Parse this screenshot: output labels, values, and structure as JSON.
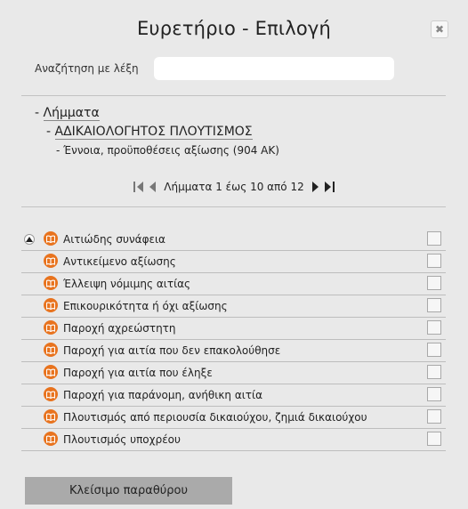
{
  "dialog": {
    "title": "Ευρετήριο - Επιλογή",
    "close_icon": "close-icon"
  },
  "search": {
    "label": "Αναζήτηση με λέξη",
    "value": "",
    "placeholder": ""
  },
  "breadcrumb": {
    "level1": "Λήμματα",
    "level2": "ΑΔΙΚΑΙΟΛΟΓΗΤΟΣ ΠΛΟΥΤΙΣΜΟΣ",
    "level3": "Έννοια, προϋποθέσεις αξίωσης (904 ΑΚ)"
  },
  "pager": {
    "text": "Λήμματα 1 έως 10 από 12"
  },
  "entries": [
    {
      "label": "Αιτιώδης συνάφεια"
    },
    {
      "label": "Αντικείμενο αξίωσης"
    },
    {
      "label": "Έλλειψη νόμιμης αιτίας"
    },
    {
      "label": "Επικουρικότητα ή όχι αξίωσης"
    },
    {
      "label": "Παροχή αχρεώστητη"
    },
    {
      "label": "Παροχή για αιτία που δεν επακολούθησε"
    },
    {
      "label": "Παροχή για αιτία που έληξε"
    },
    {
      "label": "Παροχή για παράνομη, ανήθικη αιτία"
    },
    {
      "label": "Πλουτισμός από περιουσία δικαιούχου, ζημιά δικαιούχου"
    },
    {
      "label": "Πλουτισμός υποχρέου"
    }
  ],
  "footer": {
    "close_label": "Κλείσιμο παραθύρου"
  },
  "colors": {
    "background": "#e9e9e9",
    "book_icon": "#e8731e",
    "close_button": "#aaaaaa"
  }
}
